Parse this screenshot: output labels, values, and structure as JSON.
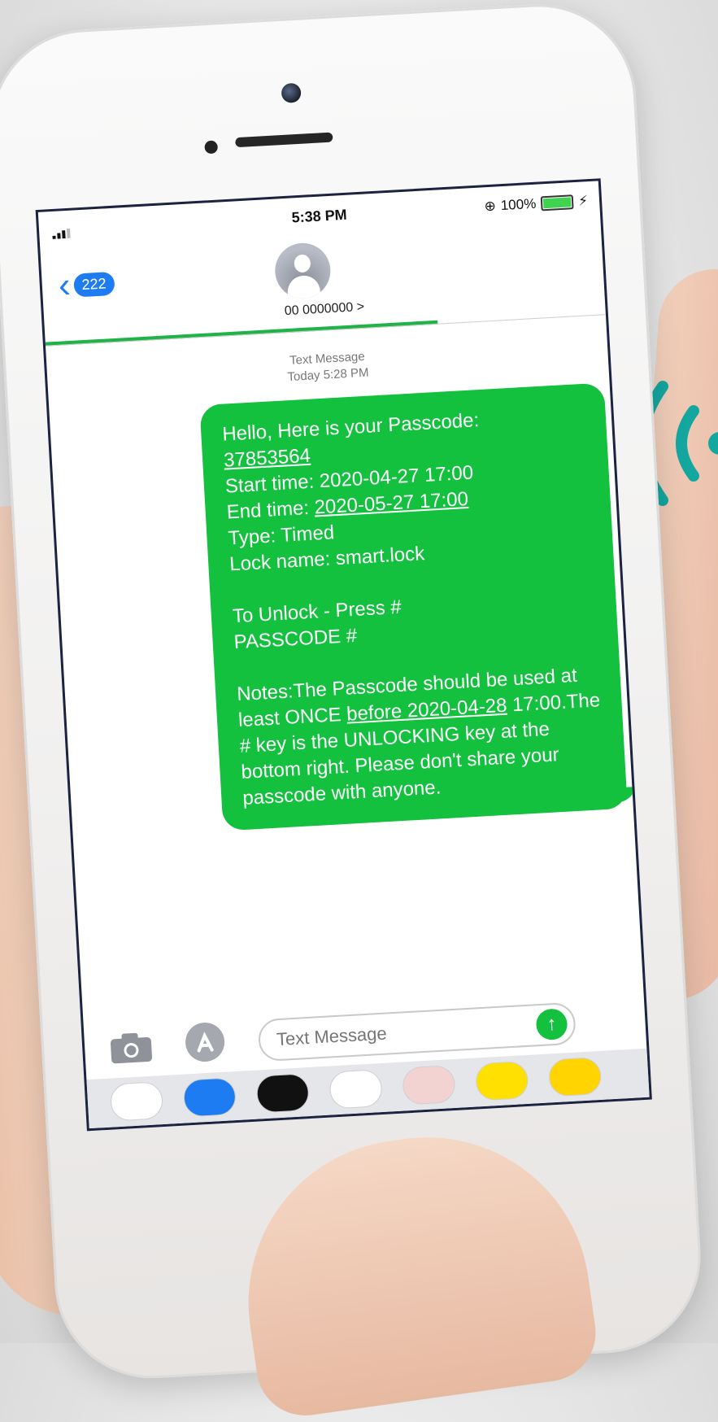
{
  "status_bar": {
    "time": "5:38 PM",
    "battery_text": "100%",
    "battery_level": 1.0
  },
  "header": {
    "back_count": "222",
    "contact_name": "00 0000000 >",
    "send_progress": 0.7
  },
  "thread": {
    "meta_line1": "Text Message",
    "meta_line2": "Today 5:28 PM"
  },
  "message": {
    "intro": "Hello, Here is your Passcode:",
    "passcode": "37853564",
    "start_label": "Start time: ",
    "start_time": "2020-04-27 17:00",
    "end_label": "End time: ",
    "end_time": "2020-05-27 17:00",
    "type_line": "Type: Timed",
    "lock_line": "Lock name: smart.lock",
    "unlock_line1": "To Unlock - Press #",
    "unlock_line2": "PASSCODE #",
    "notes_part1": "Notes:The Passcode should be used at least ONCE ",
    "notes_link": "before 2020-04-28",
    "notes_part2": " 17:00.The # key is the UNLOCKING key at the bottom right. Please don't share your passcode with anyone."
  },
  "input": {
    "placeholder": "Text Message",
    "send_icon": "arrow-up-icon"
  },
  "dock": {
    "apps": [
      {
        "name": "photos-icon",
        "color": "#ffffff"
      },
      {
        "name": "app-store-icon",
        "color": "#1e7cf2"
      },
      {
        "name": "heart-app-icon",
        "color": "#111111"
      },
      {
        "name": "pay-app-icon",
        "color": "#ffffff"
      },
      {
        "name": "sticker-app-icon",
        "color": "#f3d2d2"
      },
      {
        "name": "yellow-app-icon",
        "color": "#ffe000"
      },
      {
        "name": "weibo-icon",
        "color": "#ffd400"
      }
    ]
  },
  "colors": {
    "bubble_green": "#13c13f",
    "ios_blue": "#1e7cf2",
    "wave_teal": "#14a7a0"
  }
}
